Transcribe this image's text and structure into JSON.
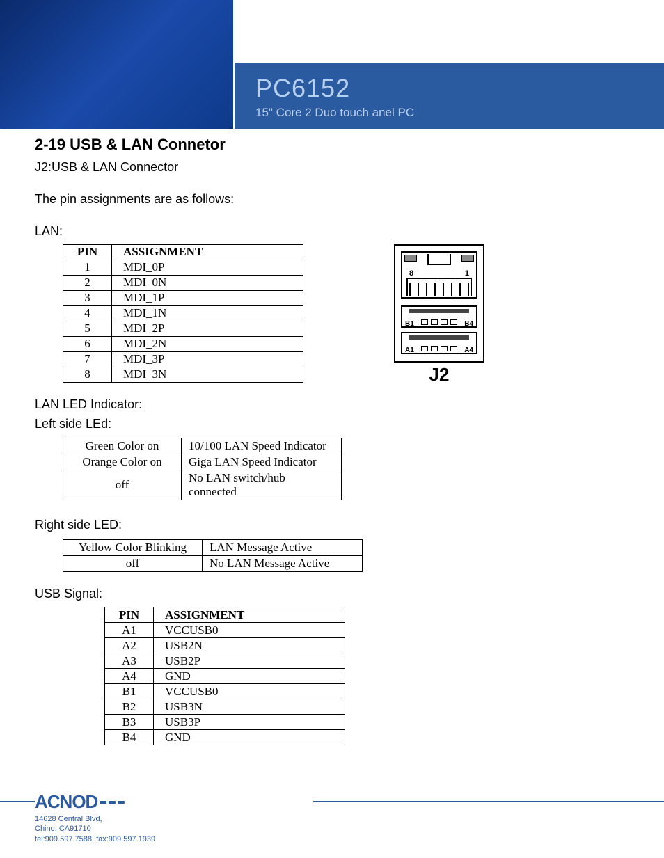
{
  "header": {
    "product_title": "PC6152",
    "product_sub": "15\" Core 2 Duo touch anel PC"
  },
  "section": {
    "title": "2-19 USB & LAN Connetor",
    "subtitle": "J2:USB & LAN Connector",
    "intro": "The pin assignments are as follows:",
    "lan_label": "LAN:",
    "led_indicator_label": "LAN LED Indicator:",
    "left_led_label": "Left side LEd:",
    "right_led_label": "Right side LED:",
    "usb_label": "USB Signal:"
  },
  "lan_table": {
    "headers": {
      "pin": "PIN",
      "assign": "ASSIGNMENT"
    },
    "rows": [
      {
        "pin": "1",
        "assign": "MDI_0P"
      },
      {
        "pin": "2",
        "assign": "MDI_0N"
      },
      {
        "pin": "3",
        "assign": "MDI_1P"
      },
      {
        "pin": "4",
        "assign": "MDI_1N"
      },
      {
        "pin": "5",
        "assign": "MDI_2P"
      },
      {
        "pin": "6",
        "assign": "MDI_2N"
      },
      {
        "pin": "7",
        "assign": "MDI_3P"
      },
      {
        "pin": "8",
        "assign": "MDI_3N"
      }
    ]
  },
  "diagram": {
    "rj_pin_left": "8",
    "rj_pin_right": "1",
    "b_left": "B1",
    "b_right": "B4",
    "a_left": "A1",
    "a_right": "A4",
    "connector_label": "J2"
  },
  "left_led_table": {
    "rows": [
      {
        "c1": "Green Color on",
        "c2": "10/100 LAN Speed Indicator"
      },
      {
        "c1": "Orange Color on",
        "c2": "Giga LAN Speed Indicator"
      },
      {
        "c1": "off",
        "c2": "No LAN switch/hub connected"
      }
    ]
  },
  "right_led_table": {
    "rows": [
      {
        "c1": "Yellow Color Blinking",
        "c2": "LAN Message Active"
      },
      {
        "c1": "off",
        "c2": "No LAN Message Active"
      }
    ]
  },
  "usb_table": {
    "headers": {
      "pin": "PIN",
      "assign": "ASSIGNMENT"
    },
    "rows": [
      {
        "pin": "A1",
        "assign": "VCCUSB0"
      },
      {
        "pin": "A2",
        "assign": "USB2N"
      },
      {
        "pin": "A3",
        "assign": "USB2P"
      },
      {
        "pin": "A4",
        "assign": "GND"
      },
      {
        "pin": "B1",
        "assign": "VCCUSB0"
      },
      {
        "pin": "B2",
        "assign": "USB3N"
      },
      {
        "pin": "B3",
        "assign": "USB3P"
      },
      {
        "pin": "B4",
        "assign": "GND"
      }
    ]
  },
  "footer": {
    "brand": "ACNOD",
    "addr1": "14628 Central Blvd,",
    "addr2": "Chino, CA91710",
    "contact": "tel:909.597.7588, fax:909.597.1939"
  }
}
